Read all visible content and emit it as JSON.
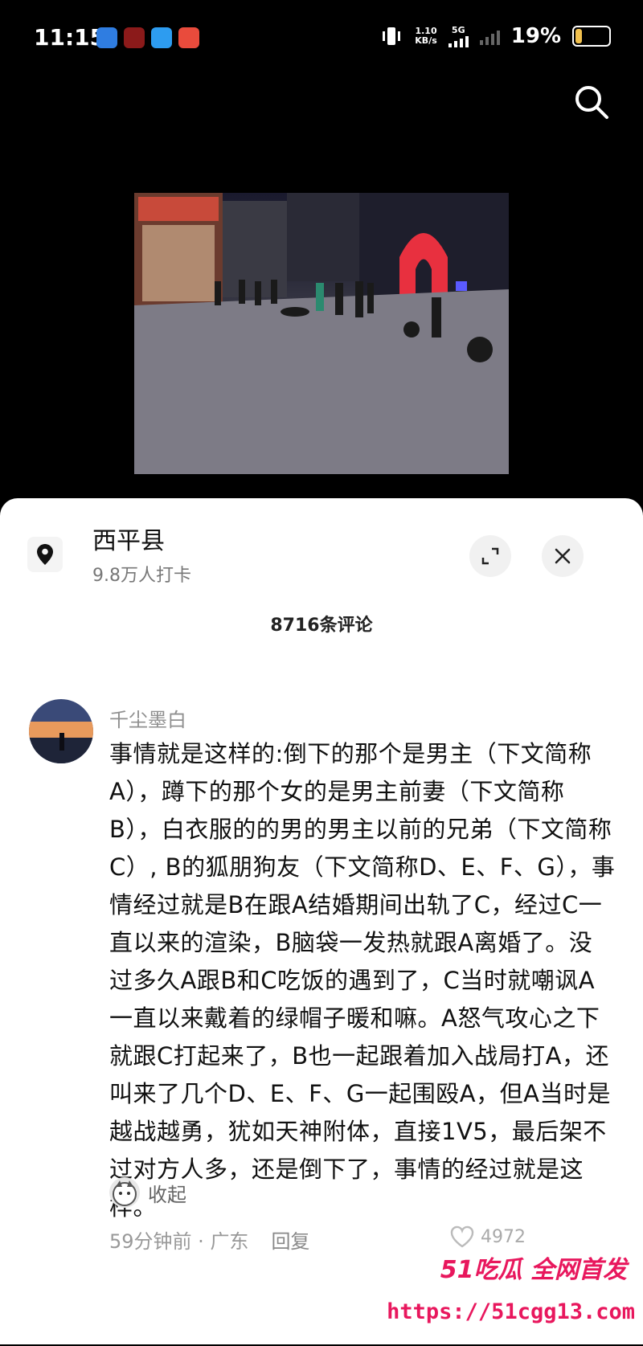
{
  "status_bar": {
    "time": "11:15",
    "net_speed_value": "1.10",
    "net_speed_unit": "KB/s",
    "network": "5G",
    "battery_pct": "19%",
    "battery_level": 0.19,
    "colors": {
      "battery": "#f2c14e"
    }
  },
  "location": {
    "name": "西平县",
    "checkins": "9.8万人打卡"
  },
  "comments_header": {
    "count_label": "8716条评论"
  },
  "comment": {
    "user": "千尘墨白",
    "text": "事情就是这样的:倒下的那个是男主（下文简称A），蹲下的那个女的是男主前妻（下文简称B），白衣服的的男的男主以前的兄弟（下文简称C）, B的狐朋狗友（下文简称D、E、F、G），事情经过就是B在跟A结婚期间出轨了C，经过C一直以来的渲染，B脑袋一发热就跟A离婚了。没过多久A跟B和C吃饭的遇到了，C当时就嘲讽A一直以来戴着的绿帽子暖和嘛。A怒气攻心之下就跟C打起来了，B也一起跟着加入战局打A，还叫来了几个D、E、F、G一起围殴A，但A当时是越战越勇，犹如天神附体，直接1V5，最后架不过对方人多，还是倒下了，事情的经过就是这样。",
    "collapse_label": "收起",
    "time": "59分钟前",
    "region": "广东",
    "reply_label": "回复",
    "like_count": "4972"
  },
  "watermark": {
    "brand": "51吃瓜 全网首发",
    "url": "https://51cgg13.com"
  }
}
